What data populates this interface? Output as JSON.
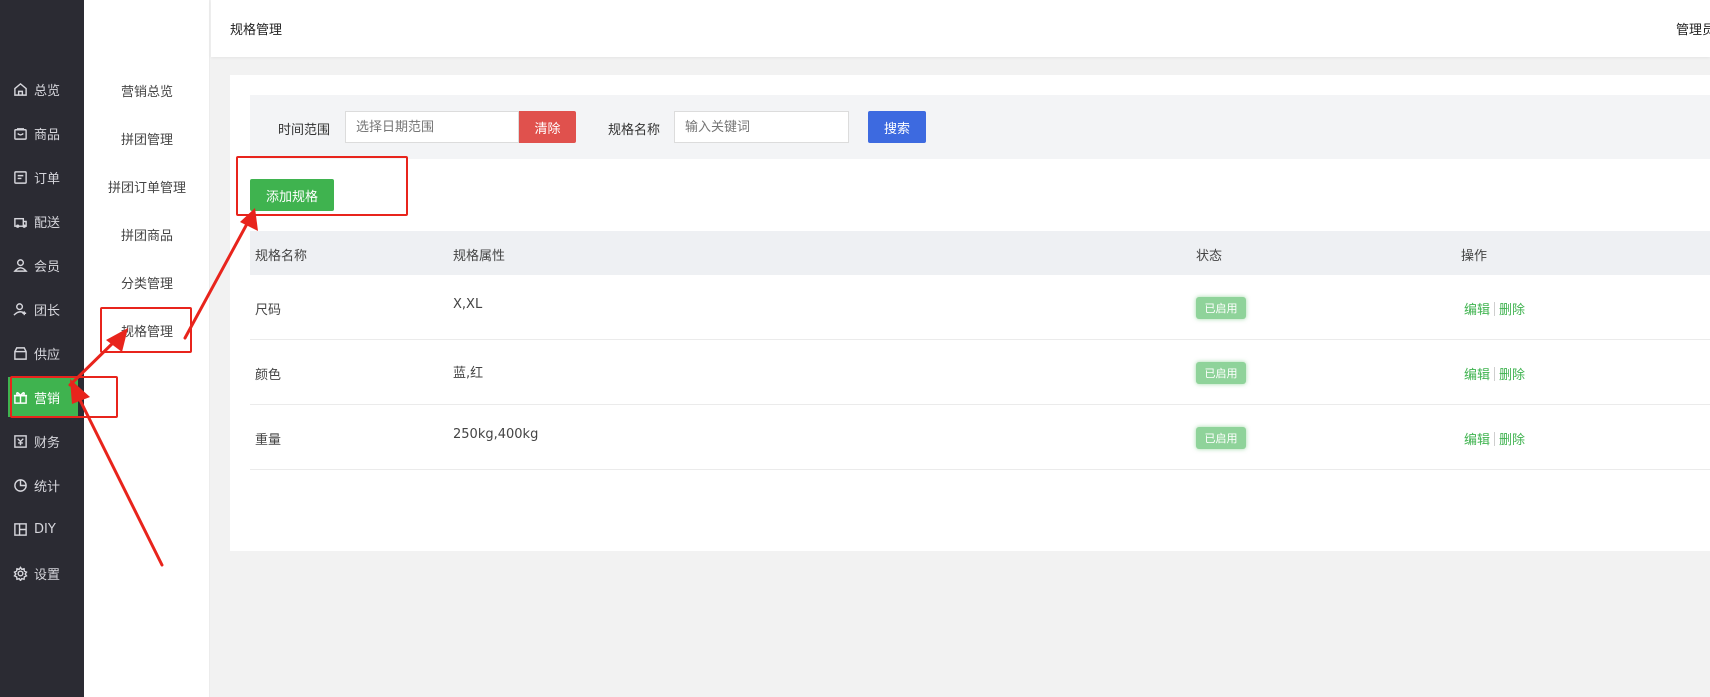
{
  "sidebar": {
    "items": [
      {
        "label": "总览",
        "icon": "home-icon"
      },
      {
        "label": "商品",
        "icon": "goods-icon"
      },
      {
        "label": "订单",
        "icon": "order-icon"
      },
      {
        "label": "配送",
        "icon": "delivery-icon"
      },
      {
        "label": "会员",
        "icon": "member-icon"
      },
      {
        "label": "团长",
        "icon": "leader-icon"
      },
      {
        "label": "供应",
        "icon": "supply-icon"
      },
      {
        "label": "营销",
        "icon": "gift-icon"
      },
      {
        "label": "财务",
        "icon": "finance-icon"
      },
      {
        "label": "统计",
        "icon": "pie-chart-icon"
      },
      {
        "label": "DIY",
        "icon": "layout-icon"
      },
      {
        "label": "设置",
        "icon": "gear-icon"
      }
    ],
    "active_index": 7
  },
  "submenu": {
    "items": [
      {
        "label": "营销总览"
      },
      {
        "label": "拼团管理"
      },
      {
        "label": "拼团订单管理"
      },
      {
        "label": "拼团商品"
      },
      {
        "label": "分类管理"
      },
      {
        "label": "规格管理"
      }
    ]
  },
  "header": {
    "title": "规格管理",
    "user": "管理员"
  },
  "filter": {
    "time_label": "时间范围",
    "date_placeholder": "选择日期范围",
    "clear_label": "清除",
    "name_label": "规格名称",
    "keyword_placeholder": "输入关键词",
    "search_label": "搜索"
  },
  "add_button_label": "添加规格",
  "table": {
    "columns": [
      "规格名称",
      "规格属性",
      "状态",
      "操作"
    ],
    "rows": [
      {
        "name": "尺码",
        "attrs": "X,XL",
        "status": "已启用",
        "edit": "编辑",
        "delete": "删除"
      },
      {
        "name": "颜色",
        "attrs": "蓝,红",
        "status": "已启用",
        "edit": "编辑",
        "delete": "删除"
      },
      {
        "name": "重量",
        "attrs": "250kg,400kg",
        "status": "已启用",
        "edit": "编辑",
        "delete": "删除"
      }
    ]
  },
  "colors": {
    "sidebar_bg": "#2b2b33",
    "accent_green": "#3fb34f",
    "danger_red": "#e0514d",
    "primary_blue": "#3d6ae0",
    "annotation_red": "#e8241c"
  }
}
